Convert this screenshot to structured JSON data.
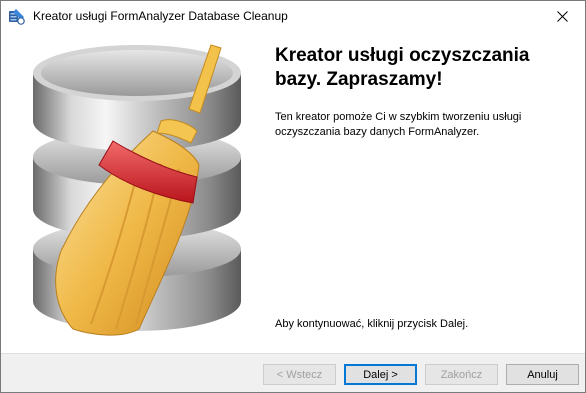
{
  "window": {
    "title": "Kreator usługi FormAnalyzer Database Cleanup",
    "close_icon": "close-icon"
  },
  "main": {
    "heading": "Kreator usługi oczyszczania bazy. Zapraszamy!",
    "description": "Ten kreator pomoże Ci w szybkim tworzeniu usługi oczyszczania bazy danych FormAnalyzer.",
    "continue_text": "Aby kontynuować, kliknij przycisk Dalej.",
    "illustration_icon": "database-broom-icon"
  },
  "footer": {
    "back_label": "< Wstecz",
    "next_label": "Dalej >",
    "finish_label": "Zakończ",
    "cancel_label": "Anuluj"
  },
  "colors": {
    "accent": "#0078d7",
    "footer_bg": "#f0f0f0",
    "broom_band": "#e0303a",
    "broom_straw": "#f2c14e"
  }
}
